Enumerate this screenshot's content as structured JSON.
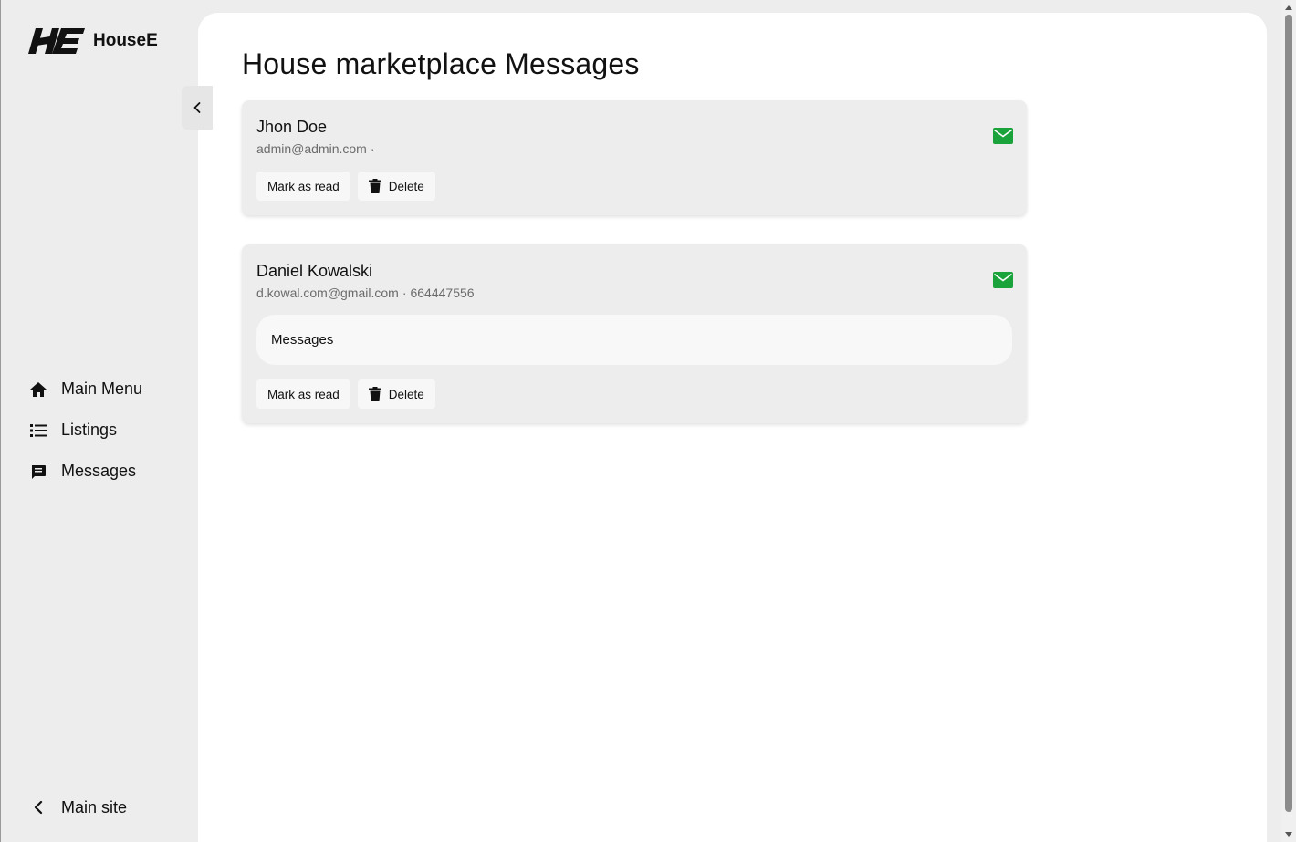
{
  "brand": {
    "name": "HouseE",
    "logo_text": "HE"
  },
  "sidebar": {
    "collapse_icon": "chevron-left-icon",
    "items": [
      {
        "label": "Main Menu",
        "icon": "home-icon"
      },
      {
        "label": "Listings",
        "icon": "list-icon"
      },
      {
        "label": "Messages",
        "icon": "chat-icon"
      }
    ],
    "footer": {
      "label": "Main site",
      "icon": "chevron-left-icon"
    }
  },
  "main": {
    "title": "House marketplace Messages",
    "messages": [
      {
        "name": "Jhon Doe",
        "email": "admin@admin.com",
        "separator": "·",
        "phone": "",
        "body": "",
        "mark_read_label": "Mark as read",
        "delete_label": "Delete"
      },
      {
        "name": "Daniel Kowalski",
        "email": "d.kowal.com@gmail.com",
        "separator": "·",
        "phone": "664447556",
        "body": "Messages",
        "mark_read_label": "Mark as read",
        "delete_label": "Delete"
      }
    ]
  },
  "colors": {
    "accent_mail": "#1aa33a",
    "sidebar_bg": "#ededed",
    "card_bg": "#ededed",
    "main_bg": "#ffffff"
  }
}
